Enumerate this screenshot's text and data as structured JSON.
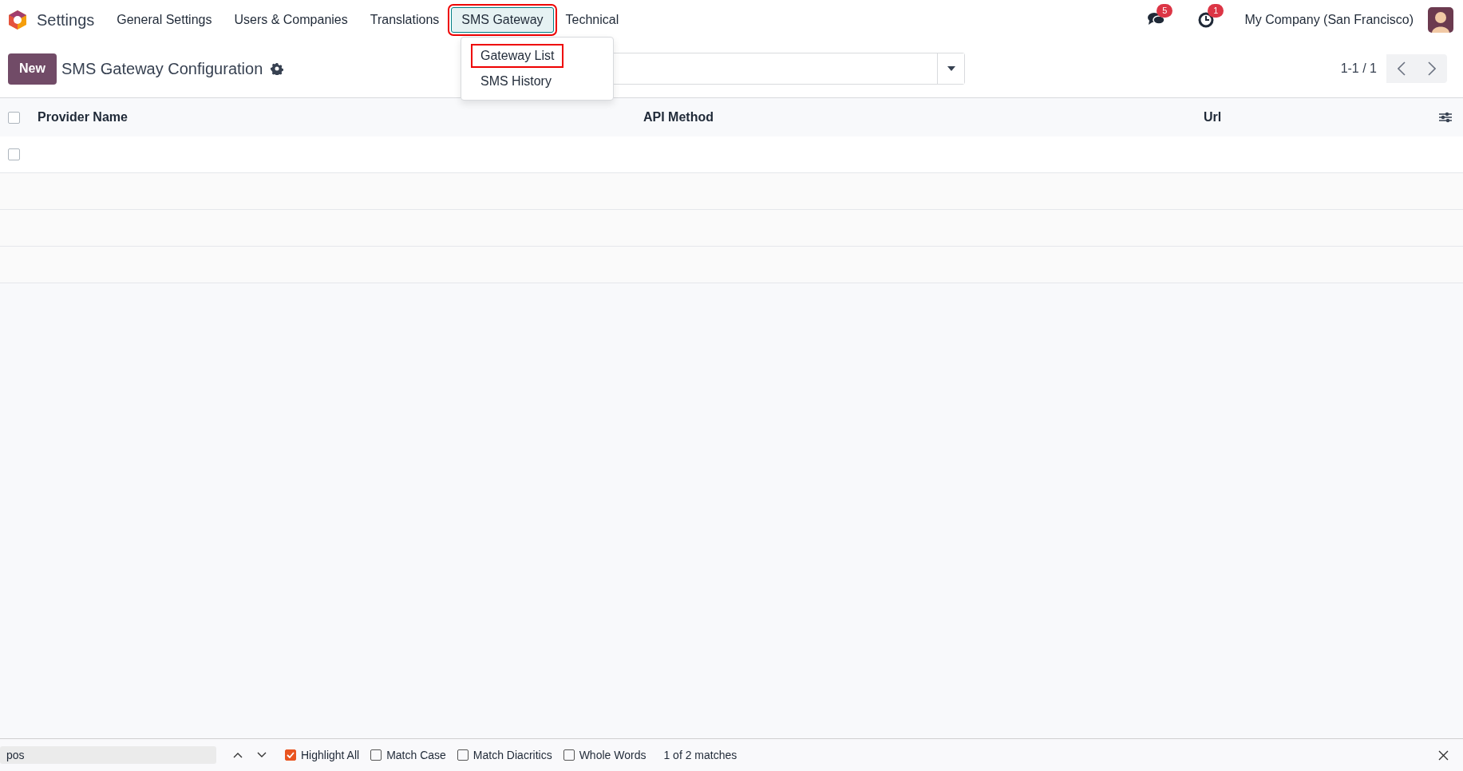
{
  "navbar": {
    "app_name": "Settings",
    "menus": [
      {
        "label": "General Settings",
        "selected": false,
        "highlighted": false
      },
      {
        "label": "Users & Companies",
        "selected": false,
        "highlighted": false
      },
      {
        "label": "Translations",
        "selected": false,
        "highlighted": false
      },
      {
        "label": "SMS Gateway",
        "selected": true,
        "highlighted": true
      },
      {
        "label": "Technical",
        "selected": false,
        "highlighted": false
      }
    ],
    "messages_badge": "5",
    "activities_badge": "1",
    "company": "My Company (San Francisco)"
  },
  "dropdown": {
    "items": [
      {
        "label": "Gateway List",
        "highlighted": true
      },
      {
        "label": "SMS History",
        "highlighted": false
      }
    ]
  },
  "control_panel": {
    "new_button": "New",
    "title": "SMS Gateway Configuration",
    "pager": "1-1 / 1"
  },
  "table": {
    "select_all_checked": false,
    "columns": [
      "Provider Name",
      "API Method",
      "Url"
    ],
    "rows": [
      {
        "checked": false
      }
    ]
  },
  "find_bar": {
    "value": "pos",
    "options": [
      {
        "label": "Highlight All",
        "checked": true
      },
      {
        "label": "Match Case",
        "checked": false
      },
      {
        "label": "Match Diacritics",
        "checked": false
      },
      {
        "label": "Whole Words",
        "checked": false
      }
    ],
    "status": "1 of 2 matches"
  }
}
